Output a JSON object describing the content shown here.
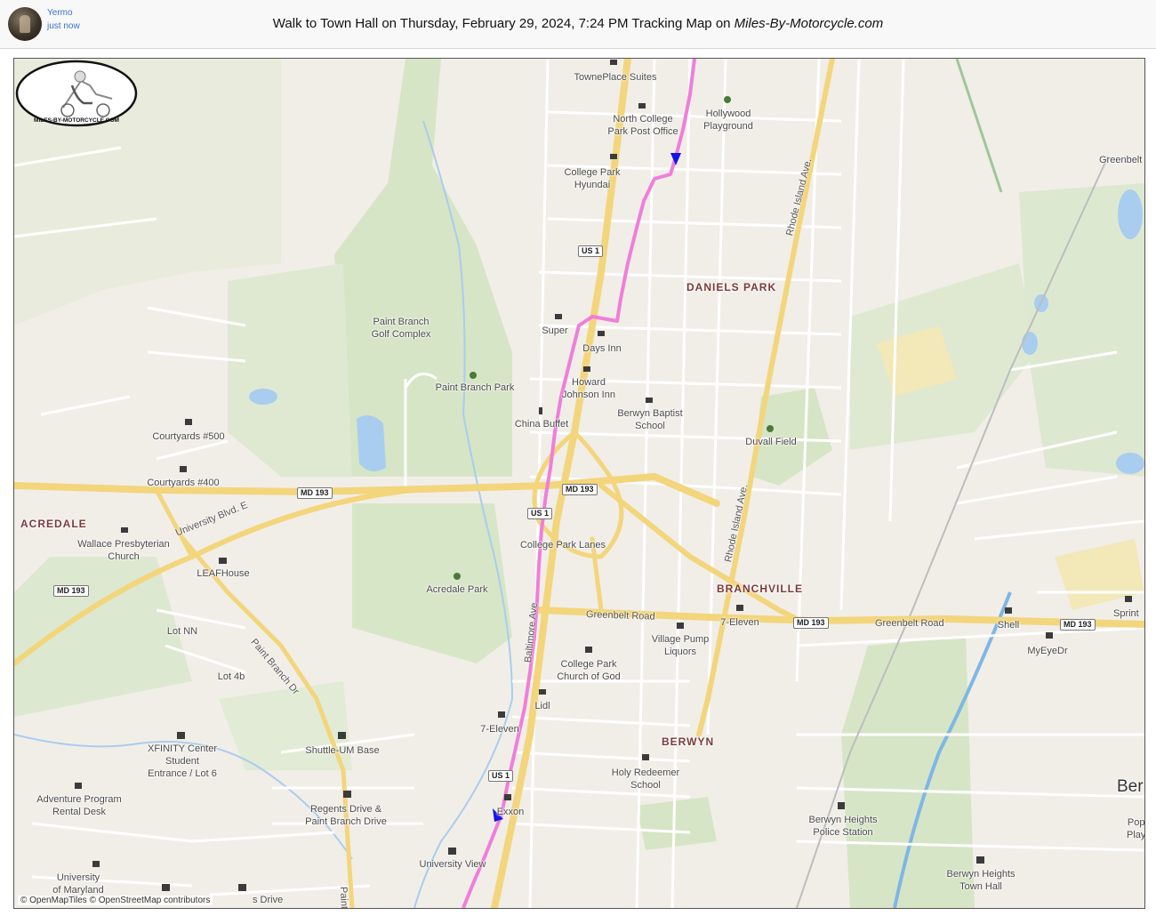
{
  "user": {
    "name": "Yermo",
    "time": "just now"
  },
  "page": {
    "title_main": "Walk to Town Hall on Thursday, February 29, 2024, 7:24 PM Tracking Map on ",
    "title_site": "Miles-By-Motorcycle.com"
  },
  "map": {
    "attribution": "© OpenMapTiles © OpenStreetMap contributors",
    "logo_text": "MILES-BY-MOTORCYCLE.COM",
    "colors": {
      "track": "#f07ed9",
      "marker": "#1414e6",
      "major_road": "#f3d57c",
      "park": "#d9e8c9",
      "water": "#a9cdef"
    },
    "areas": [
      "DANIELS PARK",
      "ACREDALE",
      "BRANCHVILLE",
      "BERWYN"
    ],
    "labels": {
      "towneplace": "TownePlace Suites",
      "post_office": "North College\nPark Post Office",
      "hollywood": "Hollywood\nPlayground",
      "greenbelt_station": "Greenbelt station",
      "hyundai": "College Park\nHyundai",
      "golf": "Paint Branch\nGolf Complex",
      "super": "Super",
      "days_inn": "Days Inn",
      "howard": "Howard\nJohnson Inn",
      "paint_branch_park": "Paint Branch Park",
      "china_buffet": "China Buffet",
      "baptist": "Berwyn Baptist\nSchool",
      "duvall": "Duvall Field",
      "courtyards500": "Courtyards #500",
      "courtyards400": "Courtyards #400",
      "wallace": "Wallace Presbyterian\nChurch",
      "leafhouse": "LEAFHouse",
      "cp_lanes": "College Park Lanes",
      "acredale_park": "Acredale Park",
      "seven_eleven_1": "7-Eleven",
      "village_pump": "Village Pump\nLiquors",
      "shell": "Shell",
      "sprint": "Sprint",
      "myeyedr": "MyEyeDr",
      "lot_nn": "Lot NN",
      "lot_4b": "Lot 4b",
      "cp_church": "College Park\nChurch of God",
      "lidl": "Lidl",
      "seven_eleven_2": "7-Eleven",
      "xfinity": "XFINITY Center\nStudent\nEntrance / Lot 6",
      "shuttle": "Shuttle-UM Base",
      "holy_redeemer": "Holy Redeemer\nSchool",
      "adventure": "Adventure Program\nRental Desk",
      "regents": "Regents Drive &\nPaint Branch Drive",
      "exxon": "Exxon",
      "berwyn_police": "Berwyn Heights\nPolice Station",
      "ber": "Ber",
      "pop": "Pop\nPlay",
      "univ_view": "University View",
      "umd": "University\nof Maryland",
      "town_hall": "Berwyn Heights\nTown Hall",
      "drive": "s Drive"
    },
    "roads": {
      "rhode1": "Rhode Island Ave.",
      "rhode2": "Rhode Island Ave.",
      "univ_blvd": "University Blvd. E",
      "greenbelt1": "Greenbelt Road",
      "greenbelt2": "Greenbelt Road",
      "baltimore": "Baltimore Ave",
      "paint_branch_dr": "Paint Branch Dr",
      "paint_b": "Paint B"
    },
    "shields": {
      "us1_a": "US 1",
      "us1_b": "US 1",
      "us1_c": "US 1",
      "md193_a": "MD 193",
      "md193_b": "MD 193",
      "md193_c": "MD 193",
      "md193_d": "MD 193",
      "md193_e": "MD 193"
    }
  }
}
